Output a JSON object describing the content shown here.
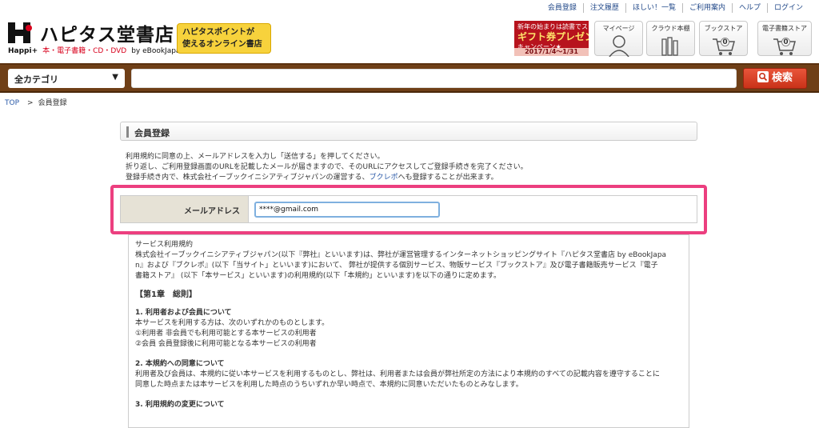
{
  "top_links": [
    "会員登録",
    "注文履歴",
    "ほしい！一覧",
    "ご利用案内",
    "ヘルプ",
    "ログイン"
  ],
  "logo": {
    "title": "ハピタス堂書店",
    "happi": "Happi+",
    "sub_red": "本・電子書籍・CD・DVD",
    "by": "by eBookJapan"
  },
  "promo_yellow": {
    "line1": "ハピタスポイントが",
    "line2": "使えるオンライン書店"
  },
  "promo_gift": {
    "top": "新年の始まりは読書でスタート！",
    "big": "ギフト券プレゼント",
    "mid": "キャンペーン★",
    "date": "2017/1/4～1/31"
  },
  "nav_buttons": [
    {
      "label": "マイページ",
      "icon": "person-icon"
    },
    {
      "label": "クラウド本棚",
      "icon": "bookshelf-icon"
    },
    {
      "label": "ブックストア",
      "icon": "cart-icon",
      "count": "0"
    },
    {
      "label": "電子書籍ストア",
      "icon": "cart-icon",
      "count": "0"
    }
  ],
  "search": {
    "category": "全カテゴリ",
    "button": "検索",
    "value": ""
  },
  "breadcrumb": {
    "top": "TOP",
    "separator": ">",
    "current": "会員登録"
  },
  "page_title": "会員登録",
  "intro": {
    "line1": "利用規約に同意の上、メールアドレスを入力し「送信する」を押してください。",
    "line2": "折り返し、ご利用登録画面のURLを記載したメールが届きますので、そのURLにアクセスしてご登録手続きを完了ください。",
    "line3_pre": "登録手続き内で、株式会社イーブックイニシアティブジャパンの運営する、",
    "line3_link": "ブクレポ",
    "line3_post": "へも登録することが出来ます。"
  },
  "form": {
    "email_label": "メールアドレス",
    "email_value": "****@gmail.com"
  },
  "terms": {
    "heading": "サービス利用規約",
    "p1": "株式会社イーブックイニシアティブジャパン(以下『弊社』といいます)は、弊社が運営管理するインターネットショッピングサイト『ハピタス堂書店 by eBookJapa",
    "p2": "n』および『ブクレポ』(以下「当サイト」といいます)において、 弊社が提供する個別サービス、物販サービス『ブックストア』及び電子書籍販売サービス『電子",
    "p3": "書籍ストア』 (以下「本サービス」といいます)の利用規約(以下「本規約」といいます)を以下の通りに定めます。",
    "chapter": "【第1章　総則】",
    "s1_title": "1. 利用者および会員について",
    "s1_l1": "本サービスを利用する方は、次のいずれかのものとします。",
    "s1_l2": "①利用者 非会員でも利用可能とする本サービスの利用者",
    "s1_l3": "②会員 会員登録後に利用可能となる本サービスの利用者",
    "s2_title": "2. 本規約への同意について",
    "s2_l1": "利用者及び会員は、本規約に従い本サービスを利用するものとし、弊社は、利用者または会員が弊社所定の方法により本規約のすべての記載内容を遵守することに",
    "s2_l2": "同意した時点または本サービスを利用した時点のうちいずれか早い時点で、本規約に同意いただいたものとみなします。",
    "s3_title": "3. 利用規約の変更について"
  }
}
